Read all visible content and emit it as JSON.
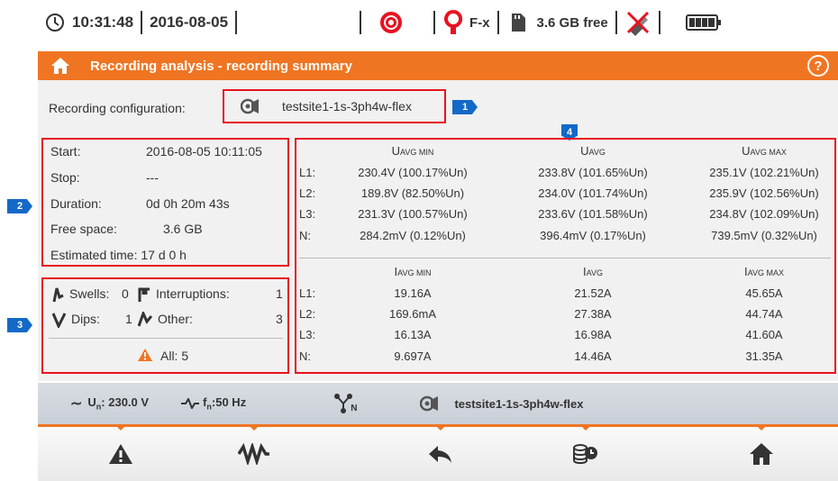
{
  "status": {
    "time": "10:31:48",
    "date": "2016-08-05",
    "clamp_type": "F-x",
    "memory": "3.6 GB free"
  },
  "header": {
    "title": "Recording analysis - recording summary",
    "help": "?"
  },
  "config": {
    "label": "Recording configuration:",
    "name": "testsite1-1s-3ph4w-flex"
  },
  "callouts": [
    "1",
    "2",
    "3",
    "4"
  ],
  "summary": {
    "start_label": "Start:",
    "start_value": "2016-08-05 10:11:05",
    "stop_label": "Stop:",
    "stop_value": "---",
    "duration_label": "Duration:",
    "duration_value": "0d 0h 20m 43s",
    "free_label": "Free space:",
    "free_value": "3.6 GB",
    "estimated": "Estimated time: 17 d 0 h"
  },
  "events": {
    "swells_label": "Swells:",
    "swells": "0",
    "interruptions_label": "Interruptions:",
    "interruptions": "1",
    "dips_label": "Dips:",
    "dips": "1",
    "other_label": "Other:",
    "other": "3",
    "all": "All: 5"
  },
  "voltage": {
    "headers": [
      {
        "main": "U",
        "sub": "AVG MIN"
      },
      {
        "main": "U",
        "sub": "AVG"
      },
      {
        "main": "U",
        "sub": "AVG MAX"
      }
    ],
    "rows": [
      {
        "ch": "L1:",
        "min": "230.4V (100.17%Un)",
        "avg": "233.8V (101.65%Un)",
        "max": "235.1V (102.21%Un)"
      },
      {
        "ch": "L2:",
        "min": "189.8V (82.50%Un)",
        "avg": "234.0V (101.74%Un)",
        "max": "235.9V (102.56%Un)"
      },
      {
        "ch": "L3:",
        "min": "231.3V (100.57%Un)",
        "avg": "233.6V (101.58%Un)",
        "max": "234.8V (102.09%Un)"
      },
      {
        "ch": "N:",
        "min": "284.2mV (0.12%Un)",
        "avg": "396.4mV (0.17%Un)",
        "max": "739.5mV (0.32%Un)"
      }
    ]
  },
  "current": {
    "headers": [
      {
        "main": "I",
        "sub": "AVG MIN"
      },
      {
        "main": "I",
        "sub": "AVG"
      },
      {
        "main": "I",
        "sub": "AVG MAX"
      }
    ],
    "rows": [
      {
        "ch": "L1:",
        "min": "19.16A",
        "avg": "21.52A",
        "max": "45.65A"
      },
      {
        "ch": "L2:",
        "min": "169.6mA",
        "avg": "27.38A",
        "max": "44.74A"
      },
      {
        "ch": "L3:",
        "min": "16.13A",
        "avg": "16.98A",
        "max": "41.60A"
      },
      {
        "ch": "N:",
        "min": "9.697A",
        "avg": "14.46A",
        "max": "31.35A"
      }
    ]
  },
  "bottom": {
    "un_main": "U",
    "un_sub": "n",
    "un_value": ": 230.0 V",
    "fn_main": "f",
    "fn_sub": "n",
    "fn_value": ":50 Hz",
    "network_sub": "N",
    "config_name": "testsite1-1s-3ph4w-flex"
  },
  "colors": {
    "accent": "#f07522",
    "callout": "#1469c7",
    "highlight": "#e8121f"
  }
}
